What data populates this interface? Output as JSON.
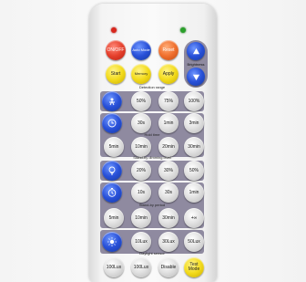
{
  "remote": {
    "buttons": {
      "on_off": "ON/OFF",
      "auto_mode": "Auto Mode",
      "reset": "Reset",
      "start": "Start",
      "memory": "Memory",
      "apply": "Apply"
    },
    "brightness": {
      "label": "Brightness"
    },
    "detection_range": {
      "caption": "Detection range",
      "options": [
        "50%",
        "75%",
        "100%"
      ]
    },
    "hold_time": {
      "caption": "Hold time",
      "options": [
        "30s",
        "1min",
        "3min",
        "5min",
        "10min",
        "20min",
        "30min"
      ]
    },
    "standby_dimming": {
      "caption": "Stand-by dimming level",
      "options": [
        "20%",
        "30%",
        "50%"
      ]
    },
    "standby_period": {
      "caption": "Stand-by period",
      "options": [
        "10s",
        "30s",
        "1min",
        "5min",
        "10min",
        "30min",
        "+∞"
      ]
    },
    "daylight": {
      "caption": "Daylight sensor",
      "options": [
        "10Lux",
        "30Lux",
        "50Lux",
        "100Lux",
        "100Lux",
        "Disable"
      ]
    },
    "test": "Test Mode"
  },
  "colors": {
    "panel": "#8f8aa0",
    "red": "#e5402c",
    "blue": "#2850d8",
    "orange": "#f0702e",
    "yellow": "#f3db1c",
    "led_red": "#d8261c",
    "led_green": "#2aa02a"
  }
}
